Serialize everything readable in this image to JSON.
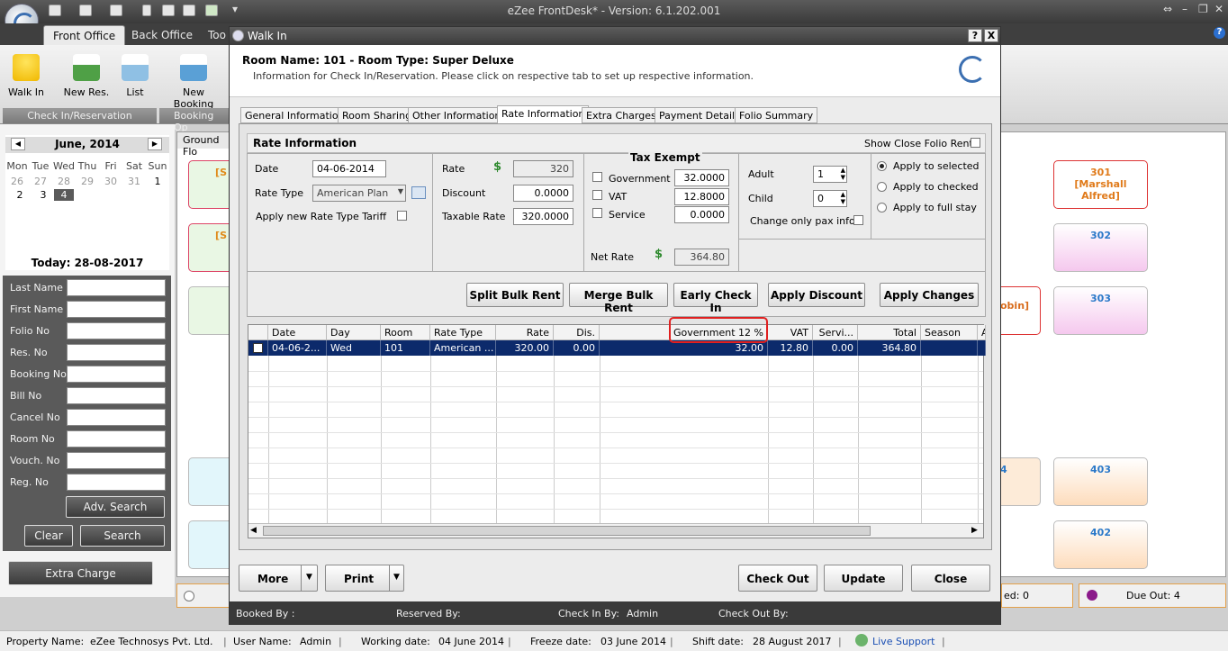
{
  "app": {
    "title": "eZee FrontDesk* - Version: 6.1.202.001"
  },
  "ribbon": {
    "tabs": [
      "Front Office",
      "Back Office",
      "Too"
    ],
    "buttons": [
      "Walk In",
      "New Res.",
      "List",
      "New Booking"
    ],
    "groups": [
      "Check In/Reservation",
      "Booking Op"
    ]
  },
  "calendar": {
    "month": "June, 2014",
    "days_of_week": [
      "Mon",
      "Tue",
      "Wed",
      "Thu",
      "Fri",
      "Sat",
      "Sun"
    ],
    "prev_days": [
      "26",
      "27",
      "28",
      "29",
      "30",
      "31"
    ],
    "days": [
      "1",
      "2",
      "3",
      "4"
    ],
    "selected": "4",
    "today": "Today: 28-08-2017"
  },
  "search": {
    "fields": [
      "Last Name",
      "First Name",
      "Folio No",
      "Res. No",
      "Booking No",
      "Bill No",
      "Cancel No",
      "Room No",
      "Vouch. No",
      "Reg. No"
    ],
    "adv": "Adv. Search",
    "clear": "Clear",
    "search": "Search",
    "extra_charge": "Extra Charge"
  },
  "floor": {
    "tab": "Ground Flo",
    "rooms": [
      {
        "number": "301",
        "guest": "[Marshall Alfred]",
        "color": "pink"
      },
      {
        "number": "302",
        "guest": "",
        "color": "lilac"
      },
      {
        "number": "303",
        "guest": "",
        "color": "lilac"
      },
      {
        "number": "403",
        "guest": "",
        "color": "peach"
      },
      {
        "number": "402",
        "guest": "",
        "color": "peach"
      }
    ],
    "partial_labels": [
      "[S",
      "[S",
      "obin]",
      "4"
    ],
    "due_out": "Due Out: 4",
    "arrived": "ed: 0"
  },
  "dialog": {
    "title": "Walk In",
    "help": "?",
    "close_x": "X",
    "room_info": "Room Name: 101 - Room Type: Super Deluxe",
    "info": "Information for Check In/Reservation. Please click on respective tab to set up respective information.",
    "tabs": [
      "General Information",
      "Room Sharing",
      "Other Information",
      "Rate Information",
      "Extra Charges",
      "Payment Details",
      "Folio Summary"
    ],
    "active_tab": "Rate Information",
    "section_title": "Rate Information",
    "show_close_folio": "Show Close Folio Rent",
    "date_label": "Date",
    "date": "04-06-2014",
    "rate_type_label": "Rate Type",
    "rate_type": "American Plan",
    "apply_tariff": "Apply new Rate Type Tariff",
    "rate_label": "Rate",
    "rate": "320",
    "discount_label": "Discount",
    "discount": "0.0000",
    "taxable_label": "Taxable Rate",
    "taxable": "320.0000",
    "tax_exempt": "Tax Exempt",
    "taxes": [
      {
        "name": "Government",
        "value": "32.0000"
      },
      {
        "name": "VAT",
        "value": "12.8000"
      },
      {
        "name": "Service",
        "value": "0.0000"
      }
    ],
    "net_rate_label": "Net Rate",
    "net_rate": "364.80",
    "adult_label": "Adult",
    "adult": "1",
    "child_label": "Child",
    "child": "0",
    "change_pax": "Change only pax info.",
    "apply_options": [
      "Apply to selected",
      "Apply to checked",
      "Apply to full stay"
    ],
    "buttons": [
      "Split Bulk Rent",
      "Merge Bulk Rent",
      "Early Check In",
      "Apply Discount",
      "Apply Changes"
    ],
    "grid": {
      "headers": [
        "Date",
        "Day",
        "Room",
        "Rate Type",
        "Rate",
        "Dis.",
        "Government 12 %",
        "VAT",
        "Servi...",
        "Total",
        "Season",
        "A"
      ],
      "row": [
        "04-06-2...",
        "Wed",
        "101",
        "American ...",
        "320.00",
        "0.00",
        "32.00",
        "12.80",
        "0.00",
        "364.80",
        ""
      ]
    },
    "bottom_buttons": {
      "more": "More",
      "print": "Print",
      "check_out": "Check Out",
      "update": "Update",
      "close": "Close"
    },
    "footer": {
      "booked_by": "Booked By :",
      "reserved_by": "Reserved By:",
      "check_in_by": "Check In By:",
      "check_in_value": "Admin",
      "check_out_by": "Check Out By:"
    }
  },
  "statusbar": {
    "property_label": "Property Name:",
    "property": "eZee Technosys Pvt. Ltd.",
    "user_label": "User Name:",
    "user": "Admin",
    "working_label": "Working date:",
    "working": "04 June 2014",
    "freeze_label": "Freeze date:",
    "freeze": "03 June 2014",
    "shift_label": "Shift date:",
    "shift": "28 August 2017",
    "live": "Live Support"
  },
  "colors": {
    "selected_row": "#0c2a6b",
    "highlight": "#e02020",
    "brand": "#3b6fb1"
  }
}
